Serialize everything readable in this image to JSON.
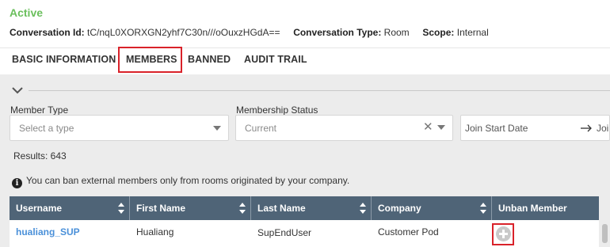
{
  "conversation": {
    "status": "Active",
    "id_label": "Conversation Id:",
    "id_value": "tC/nqL0XORXGN2yhf7C30n///oOuxzHGdA==",
    "type_label": "Conversation Type:",
    "type_value": "Room",
    "scope_label": "Scope:",
    "scope_value": "Internal"
  },
  "tabs": [
    {
      "label": "BASIC INFORMATION"
    },
    {
      "label": "MEMBERS"
    },
    {
      "label": "BANNED"
    },
    {
      "label": "AUDIT TRAIL"
    }
  ],
  "active_tab": "MEMBERS",
  "filters": {
    "member_type": {
      "label": "Member Type",
      "placeholder": "Select a type"
    },
    "membership_status": {
      "label": "Membership Status",
      "value": "Current"
    },
    "join_date": {
      "start_placeholder": "Join Start Date",
      "end_placeholder": "Joi"
    }
  },
  "results": "Results: 643",
  "info_text": "You can ban external members only from rooms originated by your company.",
  "table": {
    "columns": [
      "Username",
      "First Name",
      "Last Name",
      "Company",
      "Unban Member"
    ],
    "rows": [
      {
        "username": "hualiang_SUP",
        "first_name": "Hualiang",
        "last_name": "SupEndUser",
        "company": "Customer Pod"
      }
    ]
  },
  "colors": {
    "status": "#6abf5c",
    "table_header": "#4f6477",
    "link": "#4a90d9",
    "highlight": "#d9222a"
  },
  "icons": [
    "chevron-down-icon",
    "caret-down-icon",
    "clear-icon",
    "arrow-right-icon",
    "info-icon",
    "sort-icon",
    "plus-circle-icon"
  ]
}
